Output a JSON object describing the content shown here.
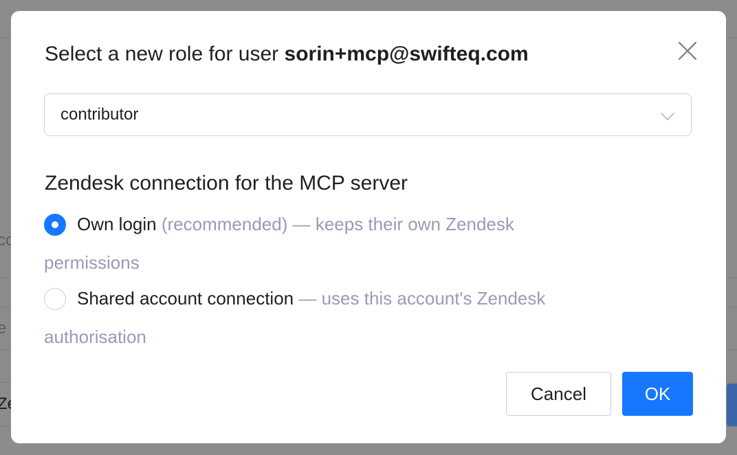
{
  "background": {
    "fragments": [
      "cc",
      "e",
      "Ze"
    ]
  },
  "dialog": {
    "title_prefix": "Select a new role for user",
    "title_user": "sorin+mcp@swifteq.com",
    "role_select": {
      "value": "contributor"
    },
    "connection": {
      "heading": "Zendesk connection for the MCP server",
      "options": [
        {
          "label": "Own login",
          "description": "(recommended) — keeps their own Zendesk permissions",
          "checked": true
        },
        {
          "label": "Shared account connection",
          "description": "— uses this account's Zendesk authorisation",
          "checked": false
        }
      ]
    },
    "buttons": {
      "cancel": "Cancel",
      "ok": "OK"
    }
  },
  "colors": {
    "primary": "#1677ff",
    "muted_text": "#9a9ab8",
    "overlay": "#8c8c8c"
  },
  "icons": {
    "close": "close-icon",
    "select_chevron": "chevron-down-icon"
  }
}
